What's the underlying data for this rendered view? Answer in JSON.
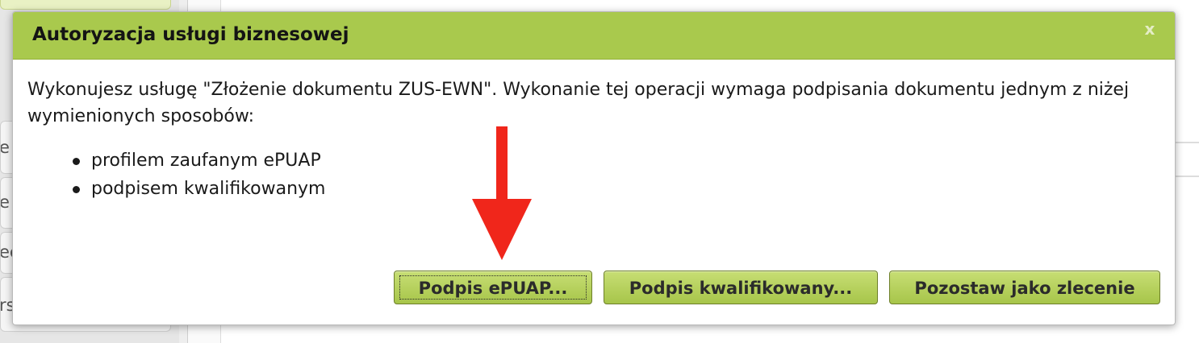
{
  "background": {
    "left_items": [
      "e",
      "e",
      "ec",
      "rs"
    ]
  },
  "dialog": {
    "title": "Autoryzacja usługi biznesowej",
    "close_label": "x",
    "message": "Wykonujesz usługę \"Złożenie dokumentu ZUS-EWN\". Wykonanie tej operacji wymaga podpisania dokumentu jednym z niżej wymienionych sposobów:",
    "options": [
      "profilem zaufanym ePUAP",
      "podpisem kwalifikowanym"
    ],
    "buttons": {
      "epuap": "Podpis ePUAP...",
      "qualified": "Podpis kwalifikowany...",
      "leave_as_order": "Pozostaw jako zlecenie"
    }
  },
  "colors": {
    "header_green": "#a9c94d",
    "button_green": "#b6d25f",
    "arrow_red": "#f0261b"
  }
}
